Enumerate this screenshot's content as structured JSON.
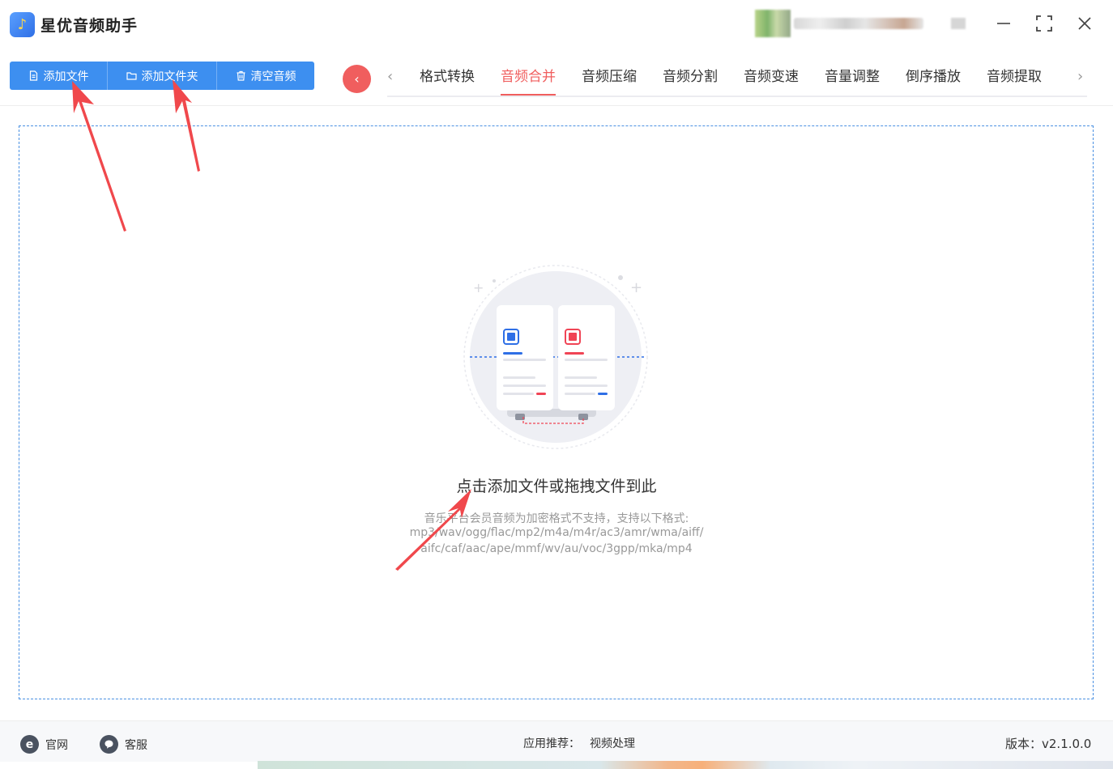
{
  "app": {
    "title": "星优音频助手",
    "logo_icon": "music-note-icon"
  },
  "window": {
    "minimize_icon": "minimize-icon",
    "maximize_icon": "maximize-icon",
    "close_icon": "close-icon"
  },
  "toolbar": {
    "add_file": "添加文件",
    "add_folder": "添加文件夹",
    "clear_audio": "清空音频"
  },
  "tabs": [
    {
      "label": "格式转换",
      "active": false
    },
    {
      "label": "音频合并",
      "active": true
    },
    {
      "label": "音频压缩",
      "active": false
    },
    {
      "label": "音频分割",
      "active": false
    },
    {
      "label": "音频变速",
      "active": false
    },
    {
      "label": "音量调整",
      "active": false
    },
    {
      "label": "倒序播放",
      "active": false
    },
    {
      "label": "音频提取",
      "active": false
    }
  ],
  "dropzone": {
    "title": "点击添加文件或拖拽文件到此",
    "hint_line1": "音乐平台会员音频为加密格式不支持，支持以下格式:",
    "hint_line2": "mp3/wav/ogg/flac/mp2/m4a/m4r/ac3/amr/wma/aiff/",
    "hint_line3": "aifc/caf/aac/ape/mmf/wv/au/voc/3gpp/mka/mp4"
  },
  "footer": {
    "website": "官网",
    "support": "客服",
    "recommend_label": "应用推荐：",
    "recommend_link": "视频处理",
    "version": "版本：v2.1.0.0"
  },
  "colors": {
    "accent_blue": "#3d8ff0",
    "accent_red": "#f05e5e",
    "dropzone_border": "#4a90e2"
  }
}
